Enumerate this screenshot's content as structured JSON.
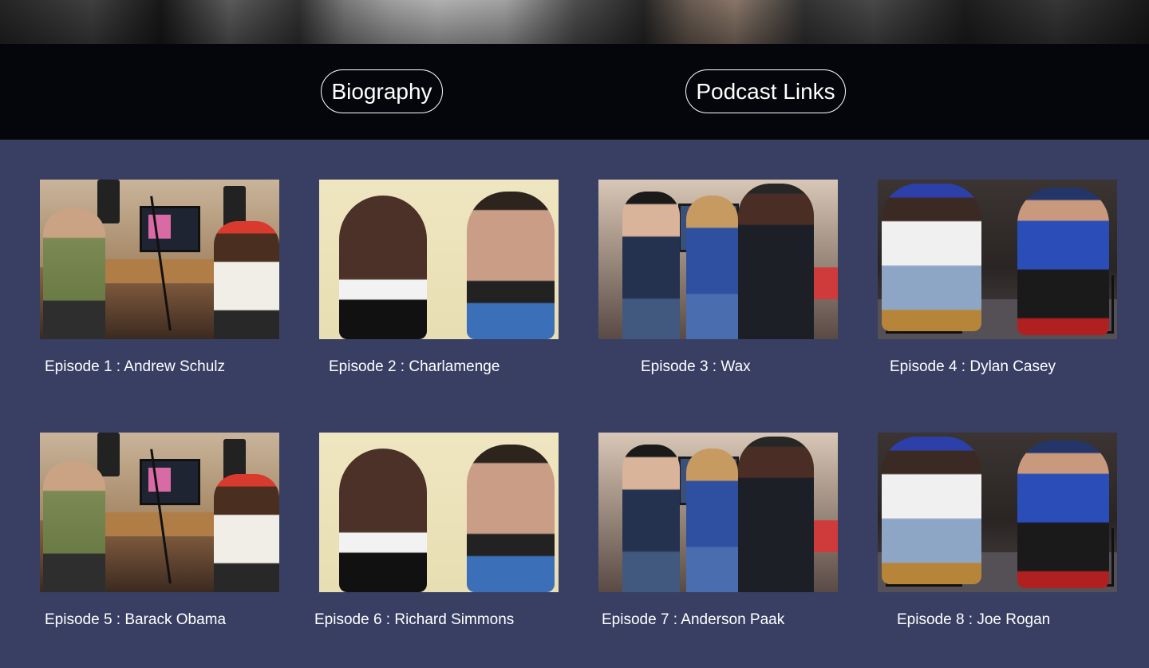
{
  "nav": {
    "items": [
      {
        "label": "Biography"
      },
      {
        "label": "Podcast Links"
      }
    ]
  },
  "episodes": [
    {
      "title": "Episode 1 : Andrew Schulz",
      "thumb": "studio"
    },
    {
      "title": "Episode 2 : Charlamenge",
      "thumb": "poster"
    },
    {
      "title": "Episode 3 : Wax",
      "thumb": "trio"
    },
    {
      "title": "Episode 4 : Dylan Casey",
      "thumb": "stage"
    },
    {
      "title": "Episode 5 : Barack Obama",
      "thumb": "studio"
    },
    {
      "title": "Episode 6 : Richard Simmons",
      "thumb": "poster"
    },
    {
      "title": "Episode 7 : Anderson Paak",
      "thumb": "trio"
    },
    {
      "title": "Episode 8 : Joe Rogan",
      "thumb": "stage"
    }
  ],
  "colors": {
    "page_background": "#383f63",
    "navbar_background": "#05060b",
    "text": "#ffffff"
  }
}
